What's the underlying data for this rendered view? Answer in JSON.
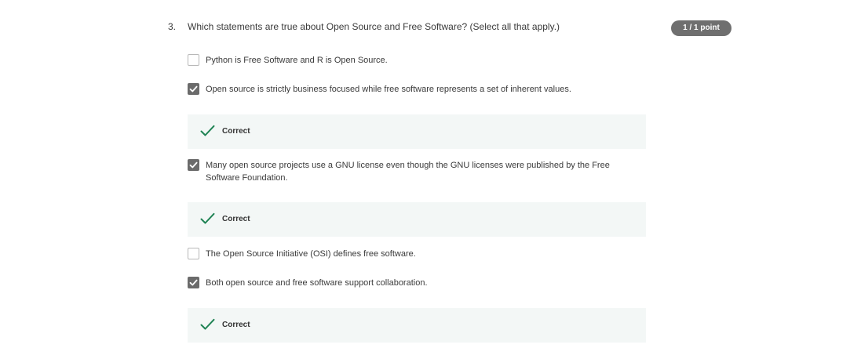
{
  "question": {
    "number": "3.",
    "text": "Which statements are true about Open Source and Free Software? (Select all that apply.)",
    "score": "1 / 1 point"
  },
  "options": [
    {
      "label": "Python is Free Software and R is Open Source.",
      "checked": false
    },
    {
      "label": "Open source is strictly business focused while free software represents a set of inherent values.",
      "checked": true,
      "feedback": "Correct"
    },
    {
      "label": "Many open source projects use a GNU license even though the GNU licenses were published by the Free Software Foundation.",
      "checked": true,
      "feedback": "Correct"
    },
    {
      "label": "The Open Source Initiative (OSI) defines free software.",
      "checked": false
    },
    {
      "label": "Both open source and free software support collaboration.",
      "checked": true,
      "feedback": "Correct"
    }
  ],
  "colors": {
    "badge_bg": "#6f6f6f",
    "checkbox_checked": "#6b6b6b",
    "feedback_bg": "#f3f7f6",
    "correct_check": "#1f8354"
  },
  "icons": {
    "checked_box": "checkbox-checked-icon",
    "unchecked_box": "checkbox-unchecked-icon",
    "correct": "correct-check-icon"
  }
}
